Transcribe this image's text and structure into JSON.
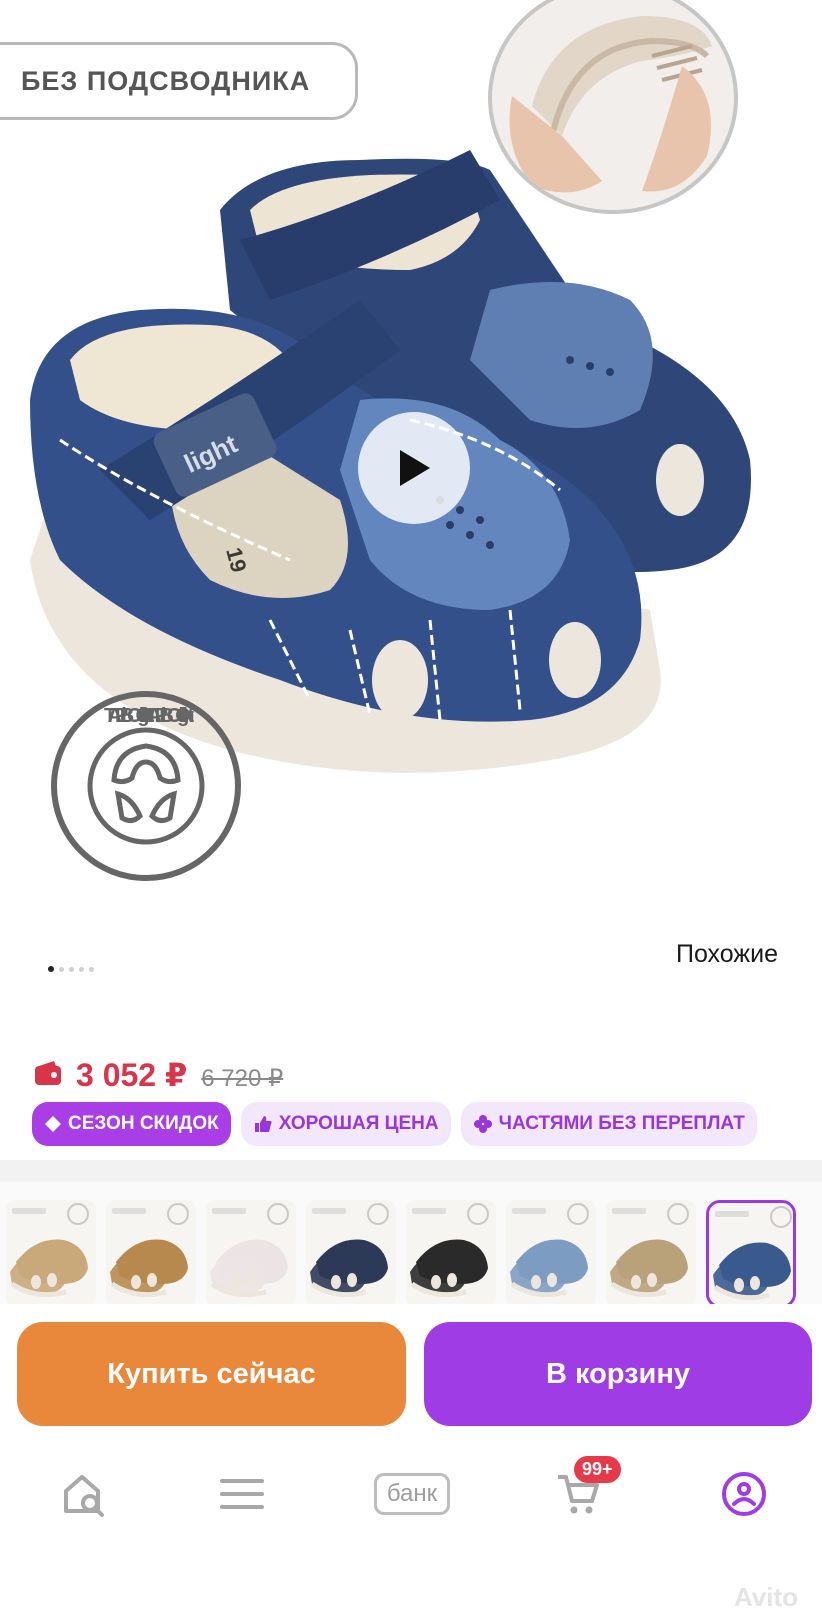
{
  "product": {
    "badge_label": "БЕЗ ПОДСВОДНИКА",
    "seal_text": "TAPiBOO · light · TAPiBOO · light",
    "shoe_logo": "light",
    "insole_size": "19",
    "similar_label": "Похожие",
    "gallery": {
      "current": 1,
      "total": 5
    }
  },
  "pricing": {
    "current_price": "3 052 ₽",
    "old_price": "6 720 ₽",
    "price_color": "#d8344a",
    "tags": [
      {
        "label": "СЕЗОН СКИДОК",
        "icon": "diamond-icon"
      },
      {
        "label": "ХОРОШАЯ ЦЕНА",
        "icon": "thumbs-up-icon"
      },
      {
        "label": "ЧАСТЯМИ БЕЗ ПЕРЕПЛАТ",
        "icon": "clover-icon"
      }
    ]
  },
  "variants": [
    {
      "color": "#c9a97a",
      "name": "sandal-variant-beige-white"
    },
    {
      "color": "#b7894f",
      "name": "sandal-variant-tan"
    },
    {
      "color": "#ece4e4",
      "name": "sandal-variant-white"
    },
    {
      "color": "#2d3a57",
      "name": "sandal-variant-navy-black"
    },
    {
      "color": "#2a2a2a",
      "name": "sandal-variant-black"
    },
    {
      "color": "#7d9cc2",
      "name": "sandal-variant-light-blue"
    },
    {
      "color": "#b9a27a",
      "name": "sandal-variant-sand"
    },
    {
      "color": "#3a5a8e",
      "name": "sandal-variant-blue",
      "selected": true
    }
  ],
  "actions": {
    "buy_now": "Купить сейчас",
    "add_to_cart": "В корзину"
  },
  "nav": {
    "home_icon": "home-search-icon",
    "menu_icon": "menu-icon",
    "bank_label": "банк",
    "cart_icon": "cart-icon",
    "cart_count": "99+",
    "profile_icon": "profile-icon"
  },
  "brand_watermark": "Avito",
  "colors": {
    "accent": "#9f3ce5",
    "buy_button": "#e9873a"
  }
}
